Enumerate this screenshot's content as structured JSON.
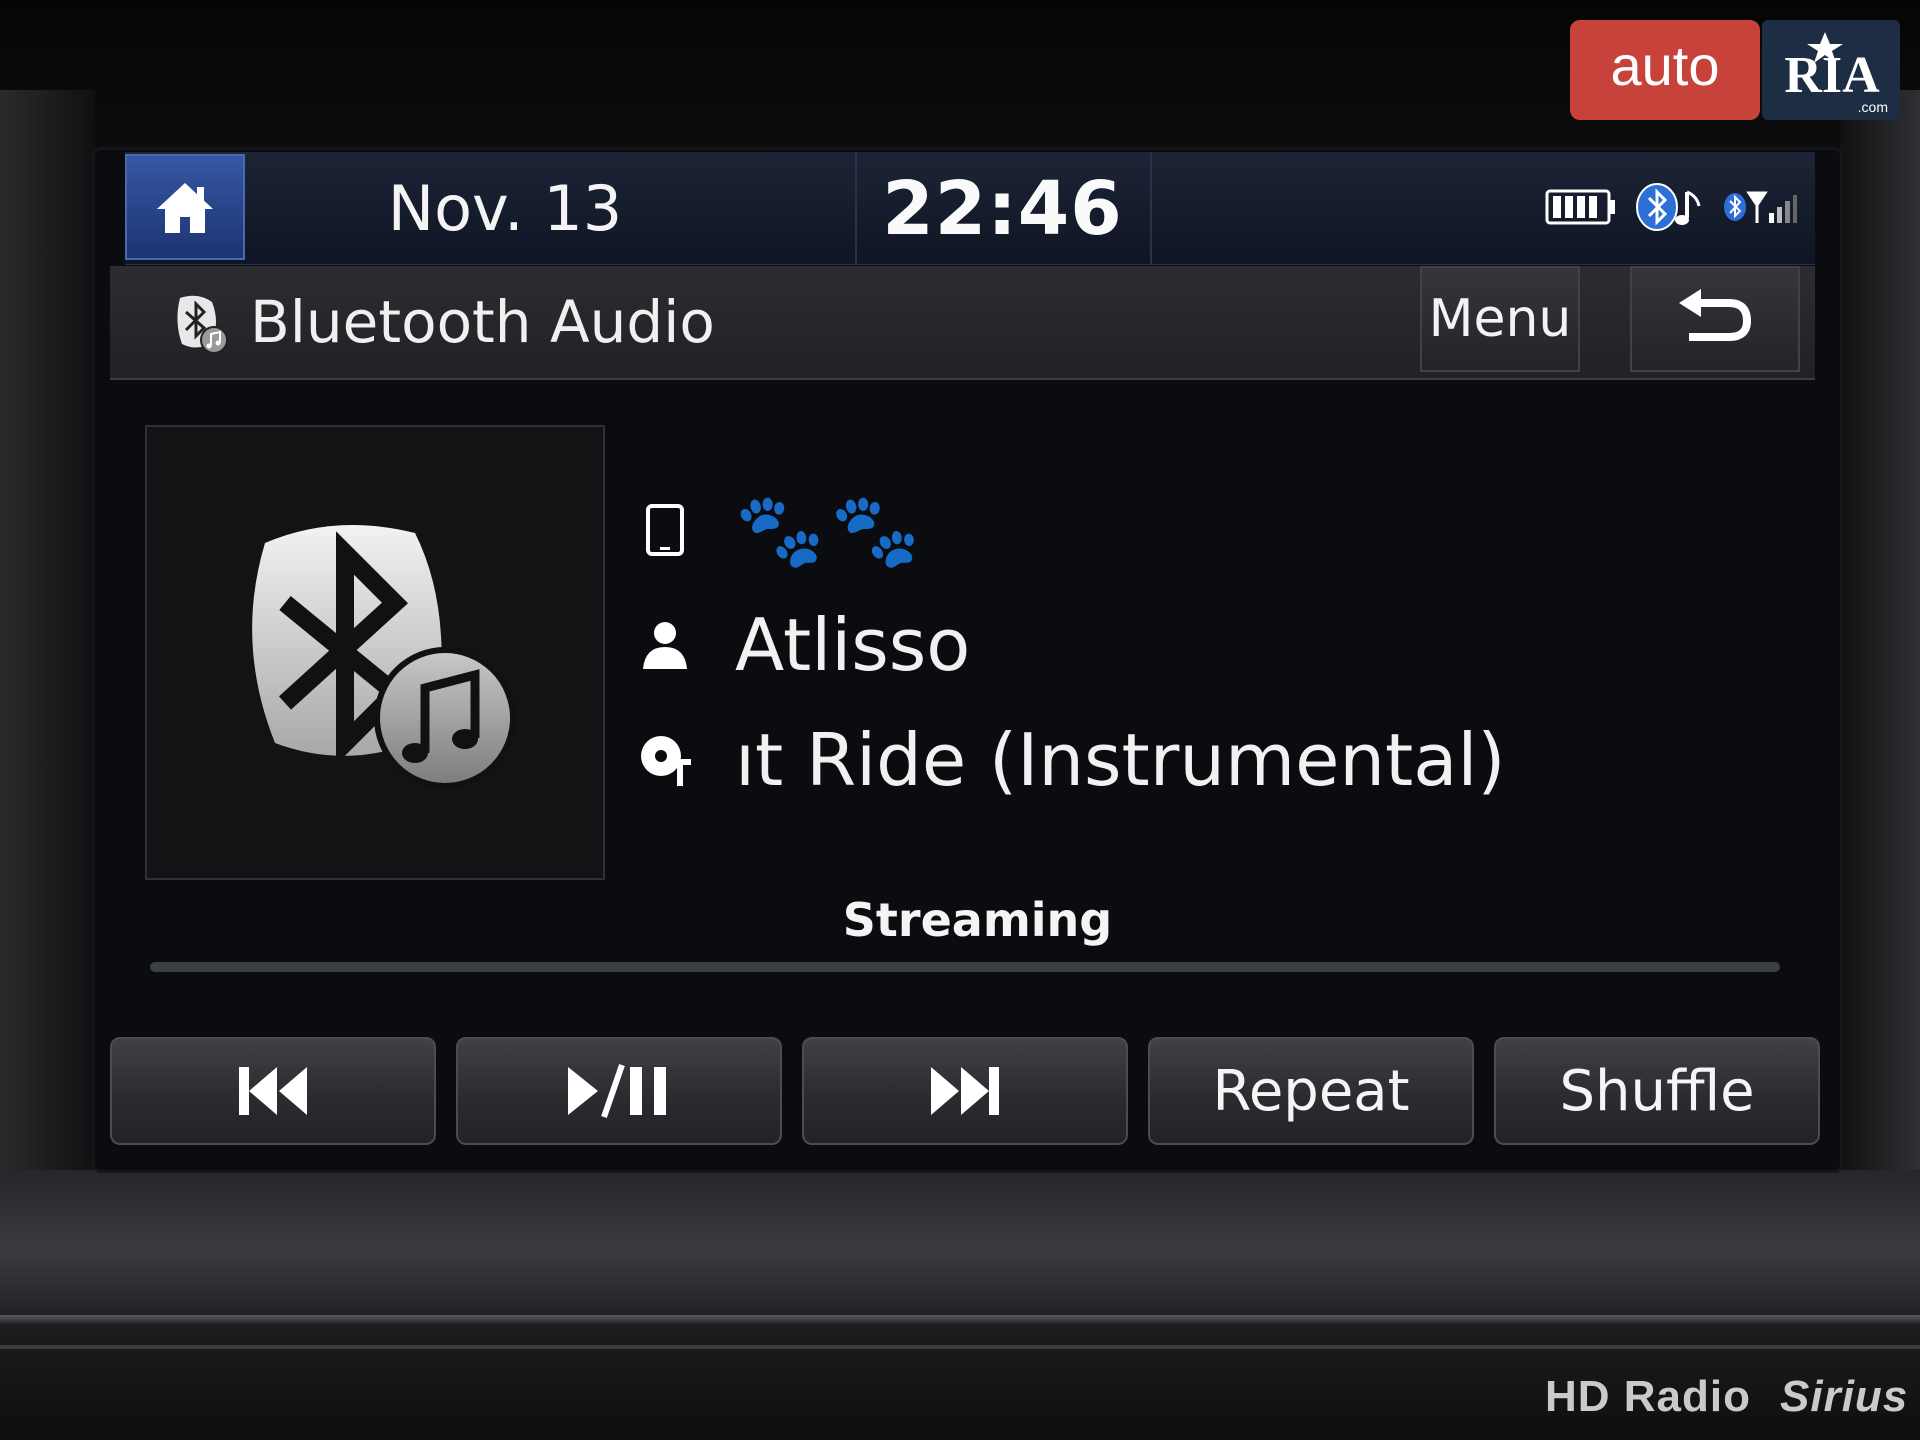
{
  "status_bar": {
    "date": "Nov. 13",
    "time": "22:46",
    "icons": [
      "home-icon",
      "battery-icon",
      "bluetooth-audio-icon",
      "bluetooth-signal-icon"
    ]
  },
  "title_bar": {
    "title": "Bluetooth Audio",
    "menu_label": "Menu",
    "back_icon": "back-arrow-icon"
  },
  "now_playing": {
    "device_name": "🐾🐾",
    "artist": "Atlisso",
    "song": "ıt Ride (Instrumental)"
  },
  "playback": {
    "mode_label": "Streaming",
    "progress": 0.0
  },
  "controls": {
    "previous_icon": "skip-previous-icon",
    "play_pause_icon": "play-pause-icon",
    "next_icon": "skip-next-icon",
    "repeat_label": "Repeat",
    "shuffle_label": "Shuffle"
  },
  "bezel": {
    "hd_radio_label": "HD Radio",
    "sirius_label": "Sirius"
  },
  "watermark": {
    "text": "auto RIA .com"
  },
  "colors": {
    "accent": "#2a4a95",
    "screen_bg": "#0a0c0f",
    "button_bg": "#2f3135"
  }
}
